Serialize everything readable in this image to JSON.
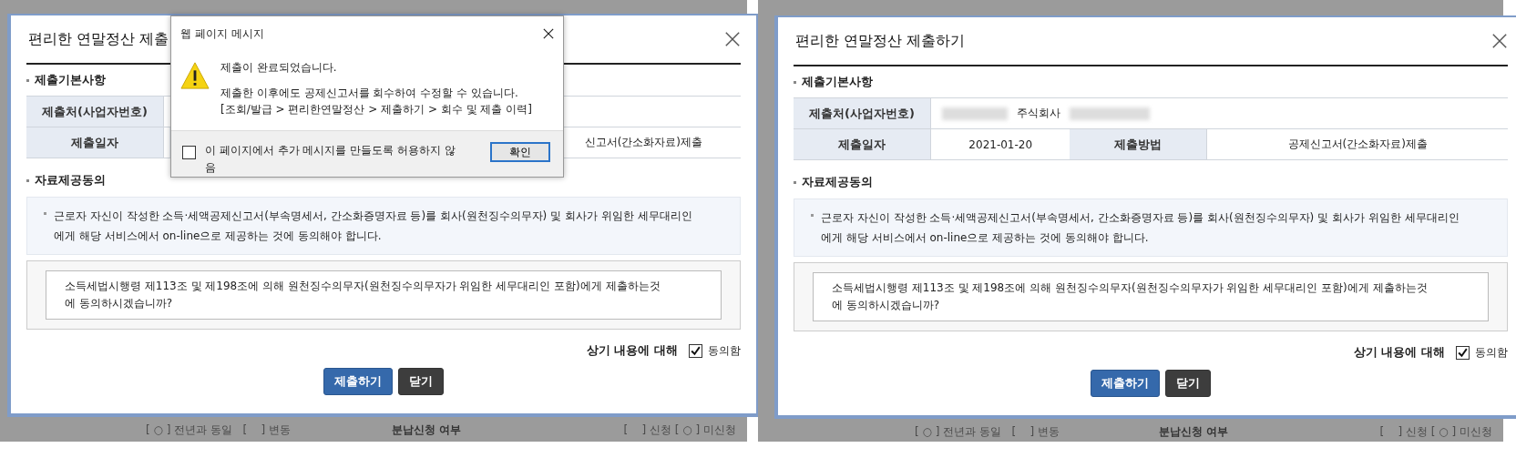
{
  "panels": [
    {
      "modal": {
        "title": "편리한 연말정산 제출",
        "section_basic": "제출기본사항",
        "rows": [
          {
            "label": "제출처(사업자번호)"
          },
          {
            "label": "제출일자",
            "value2": "신고서(간소화자료)제출"
          }
        ],
        "section_consent": "자료제공동의",
        "notice": "근로자 자신이 작성한 소득·세액공제신고서(부속명세서, 간소화증명자료 등)를 회사(원천징수의무자) 및 회사가 위임한 세무대리인에게 해당 서비스에서 on-line으로 제공하는 것에 동의해야 합니다.",
        "question": "소득세법시행령 제113조 및 제198조에 의해 원천징수의무자(원천징수의무자가 위임한 세무대리인 포함)에게 제출하는것에 동의하시겠습니까?",
        "agree_prefix": "상기 내용에 대해",
        "agree_label": "동의함",
        "agree_checked": true,
        "submit": "제출하기",
        "close": "닫기"
      },
      "dialog": {
        "title": "웹 페이지 메시지",
        "message": "제출이 완료되었습니다.",
        "detail": [
          "제출한 이후에도 공제신고서를 회수하여 수정할 수 있습니다.",
          "[조회/발급 > 편리한연말정산 > 제출하기 > 회수 및 제출 이력]"
        ],
        "checkbox_label": "이 페이지에서 추가 메시지를 만들도록 허용하지 않음",
        "checked": false,
        "ok": "확인"
      },
      "background_row": [
        "[ ○ ] 전년과 동일   [    ] 변동",
        "분납신청 여부",
        "[    ] 신청 [ ○ ] 미신청"
      ]
    },
    {
      "modal": {
        "title": "편리한 연말정산 제출하기",
        "section_basic": "제출기본사항",
        "rows": [
          {
            "label": "제출처(사업자번호)",
            "value": "주식회사",
            "redacted": true
          },
          {
            "label": "제출일자",
            "value": "2021-01-20",
            "label2": "제출방법",
            "value2": "공제신고서(간소화자료)제출"
          }
        ],
        "section_consent": "자료제공동의",
        "notice": "근로자 자신이 작성한 소득·세액공제신고서(부속명세서, 간소화증명자료 등)를 회사(원천징수의무자) 및 회사가 위임한 세무대리인에게 해당 서비스에서 on-line으로 제공하는 것에 동의해야 합니다.",
        "question": "소득세법시행령 제113조 및 제198조에 의해 원천징수의무자(원천징수의무자가 위임한 세무대리인 포함)에게 제출하는것에 동의하시겠습니까?",
        "agree_prefix": "상기 내용에 대해",
        "agree_label": "동의함",
        "agree_checked": true,
        "submit": "제출하기",
        "close": "닫기"
      },
      "background_row": [
        "[ ○ ] 전년과 동일   [    ] 변동",
        "분납신청 여부",
        "[    ] 신청 [ ○ ] 미신청"
      ]
    }
  ]
}
